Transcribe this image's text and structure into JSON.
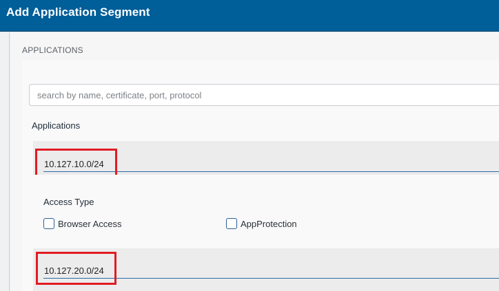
{
  "header": {
    "title": "Add Application Segment"
  },
  "section": {
    "title": "APPLICATIONS"
  },
  "search": {
    "placeholder": "search by name, certificate, port, protocol",
    "value": ""
  },
  "applications": {
    "label": "Applications",
    "entries": [
      {
        "value": "10.127.10.0/24"
      },
      {
        "value": "10.127.20.0/24"
      }
    ]
  },
  "access_type": {
    "label": "Access Type",
    "options": [
      {
        "label": "Browser Access",
        "checked": false
      },
      {
        "label": "AppProtection",
        "checked": false
      }
    ]
  },
  "colors": {
    "header_bg": "#005e99",
    "highlight": "#e11b22",
    "input_underline": "#2a6aa0"
  }
}
